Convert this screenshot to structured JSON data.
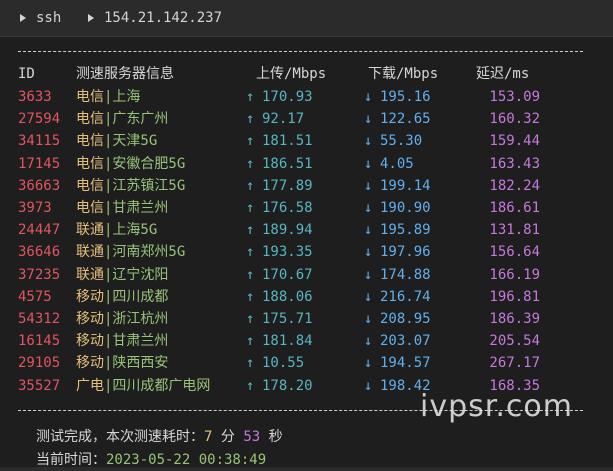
{
  "titlebar": {
    "crumbs": [
      "ssh",
      "154.21.142.237"
    ]
  },
  "table": {
    "divider": "-----------------------------------------------------------------------",
    "headers": {
      "id": "ID",
      "node": "测速服务器信息",
      "up": "上传/Mbps",
      "down": "下载/Mbps",
      "latency": "延迟/ms"
    },
    "rows": [
      {
        "id": "3633",
        "isp": "电信",
        "city": "|上海",
        "up": "170.93",
        "down": "195.16",
        "latency": "153.09"
      },
      {
        "id": "27594",
        "isp": "电信",
        "city": "|广东广州",
        "up": "92.17",
        "down": "122.65",
        "latency": "160.32"
      },
      {
        "id": "34115",
        "isp": "电信",
        "city": "|天津5G",
        "up": "181.51",
        "down": "55.30",
        "latency": "159.44"
      },
      {
        "id": "17145",
        "isp": "电信",
        "city": "|安徽合肥5G",
        "up": "186.51",
        "down": "4.05",
        "latency": "163.43"
      },
      {
        "id": "36663",
        "isp": "电信",
        "city": "|江苏镇江5G",
        "up": "177.89",
        "down": "199.14",
        "latency": "182.24"
      },
      {
        "id": "3973",
        "isp": "电信",
        "city": "|甘肃兰州",
        "up": "176.58",
        "down": "190.90",
        "latency": "186.61"
      },
      {
        "id": "24447",
        "isp": "联通",
        "city": "|上海5G",
        "up": "189.94",
        "down": "195.89",
        "latency": "131.81"
      },
      {
        "id": "36646",
        "isp": "联通",
        "city": "|河南郑州5G",
        "up": "193.35",
        "down": "197.96",
        "latency": "156.64"
      },
      {
        "id": "37235",
        "isp": "联通",
        "city": "|辽宁沈阳",
        "up": "170.67",
        "down": "174.88",
        "latency": "166.19"
      },
      {
        "id": "4575",
        "isp": "移动",
        "city": "|四川成都",
        "up": "188.06",
        "down": "216.74",
        "latency": "196.81"
      },
      {
        "id": "54312",
        "isp": "移动",
        "city": "|浙江杭州",
        "up": "175.71",
        "down": "208.95",
        "latency": "186.39"
      },
      {
        "id": "16145",
        "isp": "移动",
        "city": "|甘肃兰州",
        "up": "181.84",
        "down": "203.07",
        "latency": "205.54"
      },
      {
        "id": "29105",
        "isp": "移动",
        "city": "|陕西西安",
        "up": "10.55",
        "down": "194.57",
        "latency": "267.17"
      },
      {
        "id": "35527",
        "isp": "广电",
        "city": "|四川成都广电网",
        "up": "178.20",
        "down": "198.42",
        "latency": "168.35"
      }
    ]
  },
  "footer": {
    "done_prefix": "测试完成，本次测速耗时：",
    "minutes": "7",
    "min_unit": "分",
    "seconds": "53",
    "sec_unit": "秒",
    "time_prefix": "当前时间：",
    "time_value": "2023-05-22 00:38:49"
  },
  "watermark": "ivpsr.com",
  "colors": {
    "background": "#1e1e1e",
    "id": "#e05561",
    "isp": "#e5c07b",
    "city": "#98c379",
    "upload": "#56b6c2",
    "download": "#61afef",
    "latency": "#c678dd"
  },
  "icons": {
    "upload": "up-arrow-icon",
    "download": "down-arrow-icon"
  }
}
